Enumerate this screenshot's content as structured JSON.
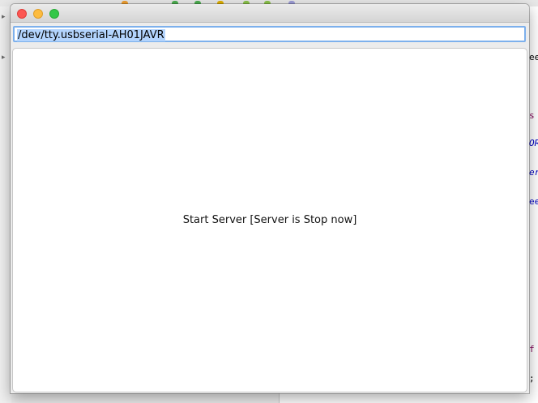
{
  "window": {
    "path_field_value": "/dev/tty.usbserial-AH01JAVR",
    "server_button_label": "Start Server [Server is Stop now]"
  },
  "background": {
    "right_fragments": [
      "ee",
      "s",
      "OR",
      "er",
      "ee",
      "f",
      ";"
    ]
  }
}
